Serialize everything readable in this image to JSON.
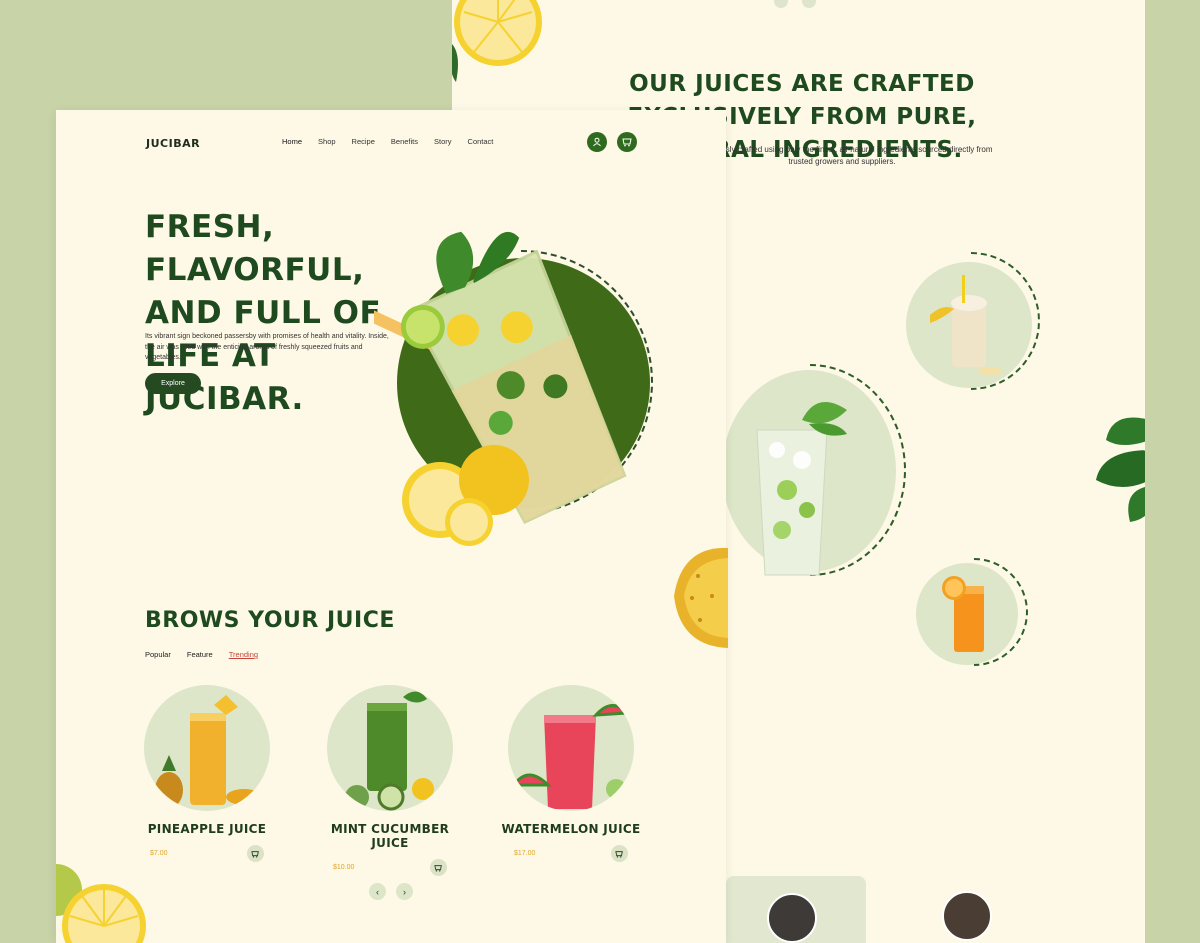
{
  "back": {
    "title": "OUR JUICES ARE CRAFTED EXCLUSIVELY FROM PURE, NATURAL INGREDIENTS.",
    "description": "Meticulously crafted using only the finest, all-natural ingredients sourced directly from trusted growers and suppliers."
  },
  "header": {
    "logo": "JUCIBAR",
    "nav": [
      "Home",
      "Shop",
      "Recipe",
      "Benefits",
      "Story",
      "Contact"
    ],
    "icons": [
      "user-icon",
      "cart-icon"
    ]
  },
  "hero": {
    "title": "FRESH, FLAVORFUL, AND FULL OF LIFE AT JUCIBAR.",
    "description": "Its vibrant sign beckoned passersby with promises of health and vitality. Inside, the air was filled with the enticing aroma of freshly squeezed fruits and vegetables.",
    "button": "Explore"
  },
  "browse": {
    "title": "BROWS YOUR JUICE",
    "tabs": [
      "Popular",
      "Feature",
      "Trending"
    ],
    "active_tab": "Trending",
    "products": [
      {
        "name": "PINEAPPLE JUICE",
        "price": "$7.00",
        "color": "#f2b12c"
      },
      {
        "name": "MINT CUCUMBER JUICE",
        "price": "$10.00",
        "color": "#4e8a2a"
      },
      {
        "name": "WATERMELON JUICE",
        "price": "$17.00",
        "color": "#e8445a"
      }
    ],
    "pager": {
      "prev": "‹",
      "next": "›"
    }
  },
  "colors": {
    "accent": "#2f6b1f",
    "background": "#fdf9e6",
    "page_bg": "#c8d3a8"
  }
}
